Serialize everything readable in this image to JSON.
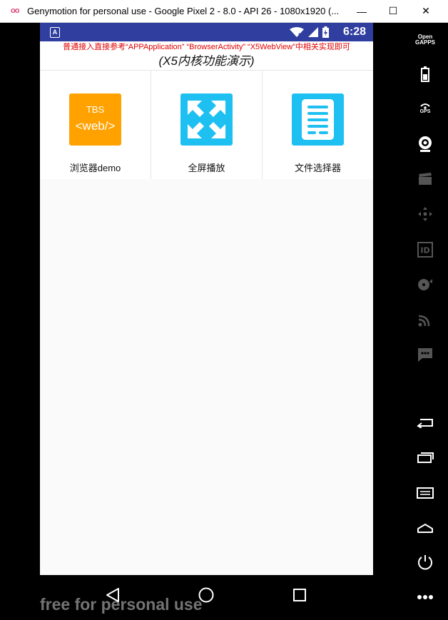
{
  "window": {
    "logo": "oo",
    "title": "Genymotion for personal use - Google Pixel 2 - 8.0 - API 26 - 1080x1920 (...",
    "minimize": "—",
    "maximize": "☐",
    "close": "✕"
  },
  "status_bar": {
    "notification_icon": "A",
    "time": "6:28",
    "icons": [
      "wifi-icon",
      "signal-icon",
      "battery-charging-icon"
    ],
    "color": "#303f9f"
  },
  "app": {
    "notice": "普通接入直接参考“APPApplication” “BrowserActivity” “X5WebView”中相关实现即可",
    "title": "(X5内核功能演示)",
    "items": [
      {
        "label": "浏览器demo",
        "icon": "tbs-web-icon",
        "icon_line1": "TBS",
        "icon_line2": "<web/>",
        "color": "#ffa200"
      },
      {
        "label": "全屏播放",
        "icon": "fullscreen-icon",
        "color": "#1ec0f2"
      },
      {
        "label": "文件选择器",
        "icon": "file-chooser-icon",
        "color": "#1ec0f2"
      }
    ]
  },
  "nav_bar": {
    "buttons": [
      "back-icon",
      "home-icon",
      "recents-icon"
    ]
  },
  "watermark": "free for personal use",
  "side_panel": {
    "open_gapps": "Open\nGAPPS",
    "gps_label": "GPS",
    "icons": [
      "open-gapps-icon",
      "battery-icon",
      "gps-icon",
      "camera-icon",
      "media-icon",
      "dpad-icon",
      "id-icon",
      "disk-icon",
      "cast-icon",
      "sms-icon",
      "back-icon",
      "recents-icon",
      "menu-icon",
      "home-icon",
      "power-icon",
      "more-icon"
    ]
  }
}
